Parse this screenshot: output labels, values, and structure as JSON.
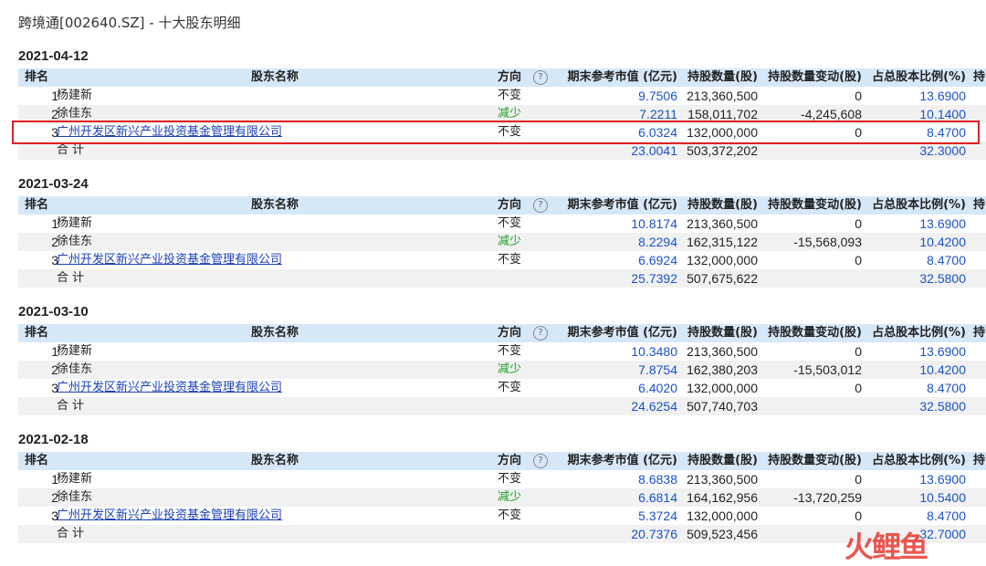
{
  "page_title": "跨境通[002640.SZ] - 十大股东明细",
  "headers": {
    "rank": "排名",
    "name": "股东名称",
    "direction": "方向",
    "help": "?",
    "value": "期末参考市值 (亿元)",
    "shares": "持股数量(股)",
    "change": "持股数量变动(股)",
    "pct": "占总股本比例(%)",
    "last": "持"
  },
  "total_label": "合计",
  "sections": [
    {
      "date": "2021-04-12",
      "rows": [
        {
          "rank": "1",
          "name": "杨建新",
          "direction": "不变",
          "value": "9.7506",
          "shares": "213,360,500",
          "change": "0",
          "pct": "13.6900"
        },
        {
          "rank": "2",
          "name": "徐佳东",
          "direction": "减少",
          "value": "7.2211",
          "shares": "158,011,702",
          "change": "-4,245,608",
          "pct": "10.1400"
        },
        {
          "rank": "3",
          "name": "广州开发区新兴产业投资基金管理有限公司",
          "direction": "不变",
          "value": "6.0324",
          "shares": "132,000,000",
          "change": "0",
          "pct": "8.4700"
        }
      ],
      "total": {
        "value": "23.0041",
        "shares": "503,372,202",
        "pct": "32.3000"
      }
    },
    {
      "date": "2021-03-24",
      "rows": [
        {
          "rank": "1",
          "name": "杨建新",
          "direction": "不变",
          "value": "10.8174",
          "shares": "213,360,500",
          "change": "0",
          "pct": "13.6900"
        },
        {
          "rank": "2",
          "name": "徐佳东",
          "direction": "减少",
          "value": "8.2294",
          "shares": "162,315,122",
          "change": "-15,568,093",
          "pct": "10.4200"
        },
        {
          "rank": "3",
          "name": "广州开发区新兴产业投资基金管理有限公司",
          "direction": "不变",
          "value": "6.6924",
          "shares": "132,000,000",
          "change": "0",
          "pct": "8.4700"
        }
      ],
      "total": {
        "value": "25.7392",
        "shares": "507,675,622",
        "pct": "32.5800"
      }
    },
    {
      "date": "2021-03-10",
      "rows": [
        {
          "rank": "1",
          "name": "杨建新",
          "direction": "不变",
          "value": "10.3480",
          "shares": "213,360,500",
          "change": "0",
          "pct": "13.6900"
        },
        {
          "rank": "2",
          "name": "徐佳东",
          "direction": "减少",
          "value": "7.8754",
          "shares": "162,380,203",
          "change": "-15,503,012",
          "pct": "10.4200"
        },
        {
          "rank": "3",
          "name": "广州开发区新兴产业投资基金管理有限公司",
          "direction": "不变",
          "value": "6.4020",
          "shares": "132,000,000",
          "change": "0",
          "pct": "8.4700"
        }
      ],
      "total": {
        "value": "24.6254",
        "shares": "507,740,703",
        "pct": "32.5800"
      }
    },
    {
      "date": "2021-02-18",
      "rows": [
        {
          "rank": "1",
          "name": "杨建新",
          "direction": "不变",
          "value": "8.6838",
          "shares": "213,360,500",
          "change": "0",
          "pct": "13.6900"
        },
        {
          "rank": "2",
          "name": "徐佳东",
          "direction": "减少",
          "value": "6.6814",
          "shares": "164,162,956",
          "change": "-13,720,259",
          "pct": "10.5400"
        },
        {
          "rank": "3",
          "name": "广州开发区新兴产业投资基金管理有限公司",
          "direction": "不变",
          "value": "5.3724",
          "shares": "132,000,000",
          "change": "0",
          "pct": "8.4700"
        }
      ],
      "total": {
        "value": "20.7376",
        "shares": "509,523,456",
        "pct": "32.7000"
      }
    }
  ],
  "watermark": "火鲤鱼",
  "colors": {
    "header_bg": "#d6e8f8",
    "value_blue": "#1a52c8",
    "decrease_green": "#1e9b2c",
    "highlight_red": "#e02020"
  }
}
